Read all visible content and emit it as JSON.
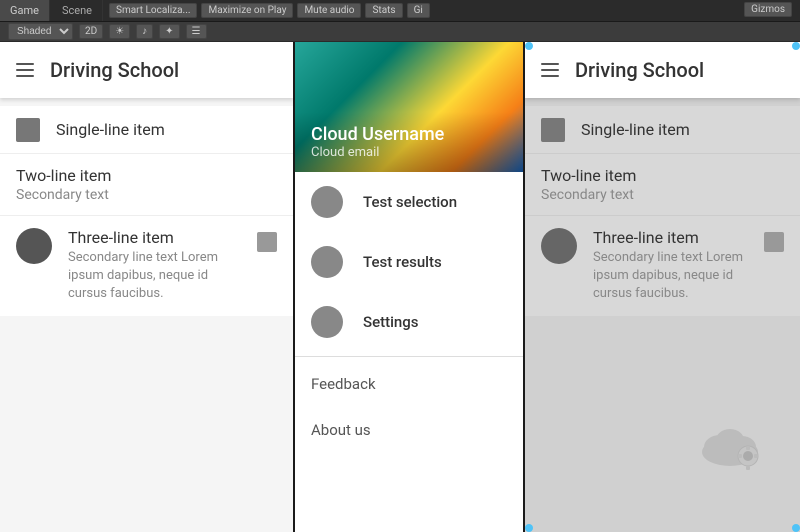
{
  "topbar": {
    "tab_game": "Game",
    "tab_scene": "Scene",
    "smart_localize": "Smart Localiza...",
    "maximize": "Maximize on Play",
    "mute_audio": "Mute audio",
    "stats": "Stats",
    "gizmos": "Gizmos",
    "shaded": "Shaded",
    "two_d": "2D"
  },
  "left_app": {
    "title": "Driving School",
    "single_line": "Single-line item",
    "two_line_primary": "Two-line item",
    "two_line_secondary": "Secondary text",
    "three_line_primary": "Three-line item",
    "three_line_secondary": "Secondary line text Lorem ipsum dapibus, neque id cursus faucibus."
  },
  "center_nav": {
    "username": "Cloud Username",
    "email": "Cloud email",
    "items": [
      {
        "label": "Test selection"
      },
      {
        "label": "Test results"
      },
      {
        "label": "Settings"
      }
    ],
    "feedback": "Feedback",
    "about": "About us"
  },
  "right_app": {
    "title": "Driving School",
    "single_line": "Single-line item",
    "two_line_primary": "Two-line item",
    "two_line_secondary": "Secondary text",
    "three_line_primary": "Three-line item",
    "three_line_secondary": "Secondary line text Lorem ipsum dapibus, neque id cursus faucibus."
  }
}
